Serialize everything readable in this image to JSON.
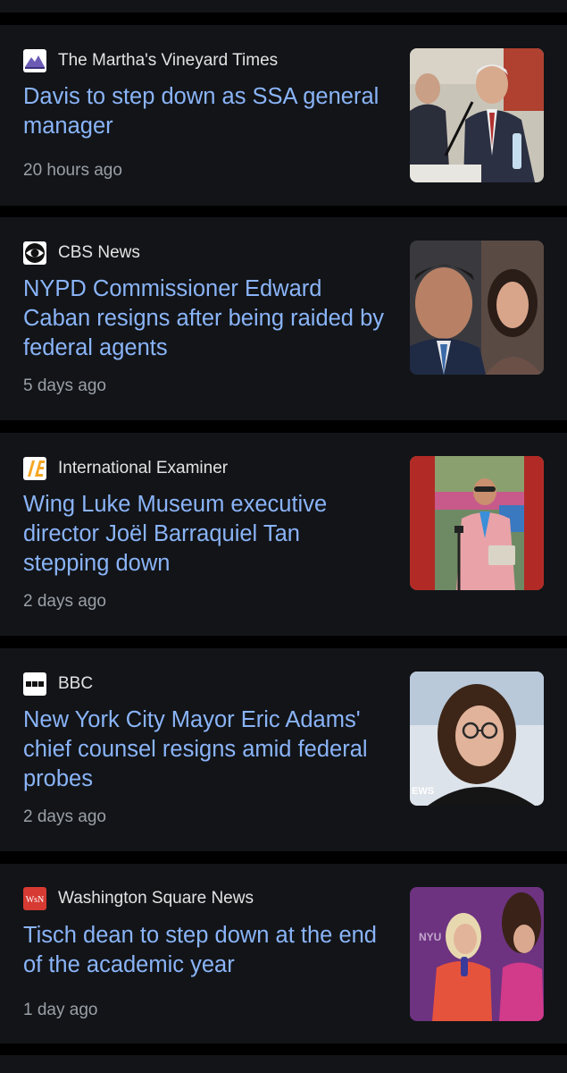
{
  "articles": [
    {
      "source": "The Martha's Vineyard Times",
      "source_logo": "mountain-logo-icon",
      "headline": "Davis to step down as SSA general manager",
      "time": "20 hours ago",
      "thumbnail": "man-in-suit-at-microphone-photo"
    },
    {
      "source": "CBS News",
      "source_logo": "cbs-eye-logo-icon",
      "headline": "NYPD Commissioner Edward Caban resigns after being raided by federal agents",
      "time": "5 days ago",
      "thumbnail": "two-people-portrait-photo"
    },
    {
      "source": "International Examiner",
      "source_logo": "ie-logo-icon",
      "headline": "Wing Luke Museum executive director Joël Barraquiel Tan stepping down",
      "time": "2 days ago",
      "thumbnail": "speaker-at-podium-photo"
    },
    {
      "source": "BBC",
      "source_logo": "bbc-logo-icon",
      "headline": "New York City Mayor Eric Adams' chief counsel resigns amid federal probes",
      "time": "2 days ago",
      "thumbnail": "woman-with-glasses-photo",
      "thumbnail_overlay_text": "EWS"
    },
    {
      "source": "Washington Square News",
      "source_logo": "wsn-logo-icon",
      "headline": "Tisch dean to step down at the end of the academic year",
      "time": "1 day ago",
      "thumbnail": "interview-at-nyu-event-photo",
      "thumbnail_overlay_text": "NYU"
    }
  ],
  "colors": {
    "page_background": "#000000",
    "card_background": "#121418",
    "headline": "#8ab4f8",
    "source_text": "#e3e3e3",
    "time_text": "#9aa0a6"
  }
}
